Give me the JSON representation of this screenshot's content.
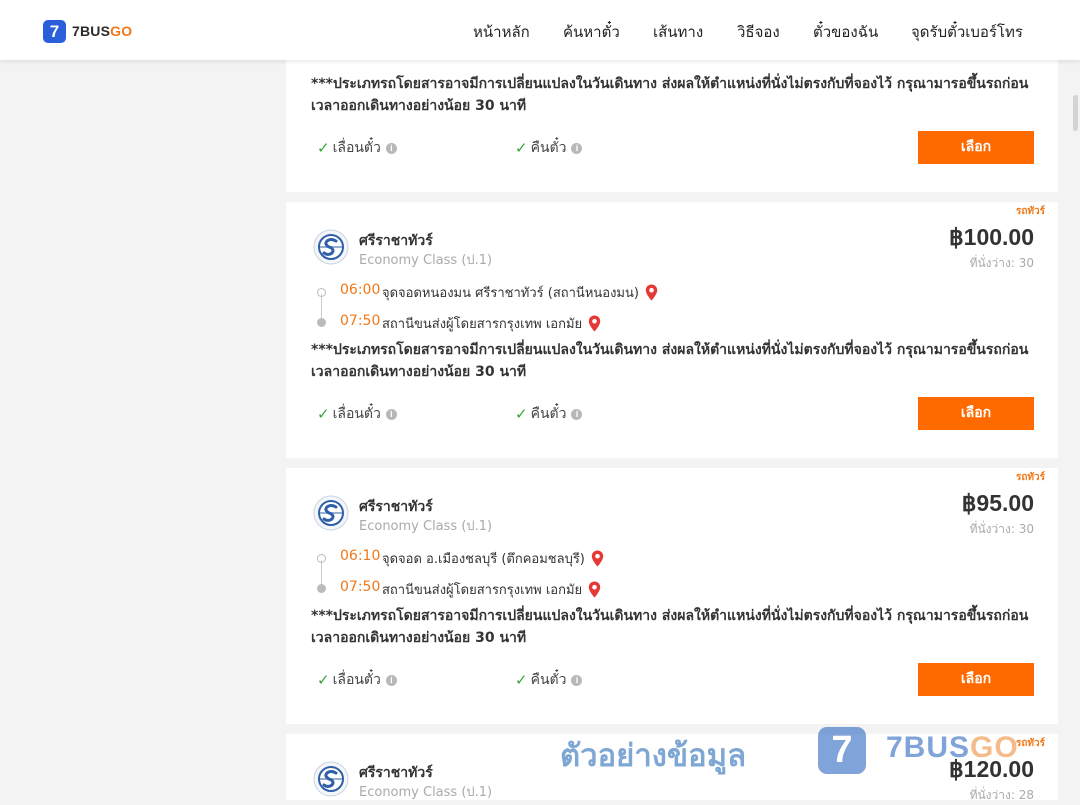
{
  "header": {
    "logo_mark": "7",
    "logo_text_a": "7BUS",
    "logo_text_b": "GO",
    "nav": [
      "หน้าหลัก",
      "ค้นหาตั๋ว",
      "เส้นทาง",
      "วิธีจอง",
      "ตั๋วของฉัน",
      "จุดรับตั๋วเบอร์โทร"
    ]
  },
  "common": {
    "note": "***ประเภทรถโดยสารอาจมีการเปลี่ยนแปลงในวันเดินทาง ส่งผลให้ตำแหน่งที่นั่งไม่ตรงกับที่จองไว้ กรุณามารอขึ้นรถก่อนเวลาออกเดินทางอย่างน้อย 30 นาที",
    "feature_change": "เลื่อนตั๋ว",
    "feature_refund": "คืนตั๋ว",
    "select_label": "เลือก",
    "tag": "รถทัวร์",
    "check_icon": "✓",
    "info_icon": "i"
  },
  "trips": [
    {
      "operator": "ศรีราชาทัวร์",
      "class": "Economy Class (ป.1)",
      "price": "฿100.00",
      "seats": "ที่นั่งว่าง: 30",
      "depart_time": "06:00",
      "depart_place": "จุดจอดหนองมน ศรีราชาทัวร์ (สถานีหนองมน)",
      "arrive_time": "07:50",
      "arrive_place": "สถานีขนส่งผู้โดยสารกรุงเทพ เอกมัย"
    },
    {
      "operator": "ศรีราชาทัวร์",
      "class": "Economy Class (ป.1)",
      "price": "฿95.00",
      "seats": "ที่นั่งว่าง: 30",
      "depart_time": "06:10",
      "depart_place": "จุดจอด อ.เมืองชลบุรี (ตึกคอมชลบุรี)",
      "arrive_time": "07:50",
      "arrive_place": "สถานีขนส่งผู้โดยสารกรุงเทพ เอกมัย"
    },
    {
      "operator": "ศรีราชาทัวร์",
      "class": "Economy Class (ป.1)",
      "price": "฿120.00",
      "seats": "ที่นั่งว่าง: 28"
    }
  ],
  "watermark": {
    "text": "ตัวอย่างข้อมูล",
    "logo_mark": "7",
    "brand_a": "7BUS",
    "brand_b": "GO"
  },
  "colors": {
    "accent": "#ff6a00",
    "brand_blue": "#2b5fd9",
    "time_orange": "#f07818",
    "check_green": "#3aa53a",
    "pin_red": "#e53935"
  }
}
